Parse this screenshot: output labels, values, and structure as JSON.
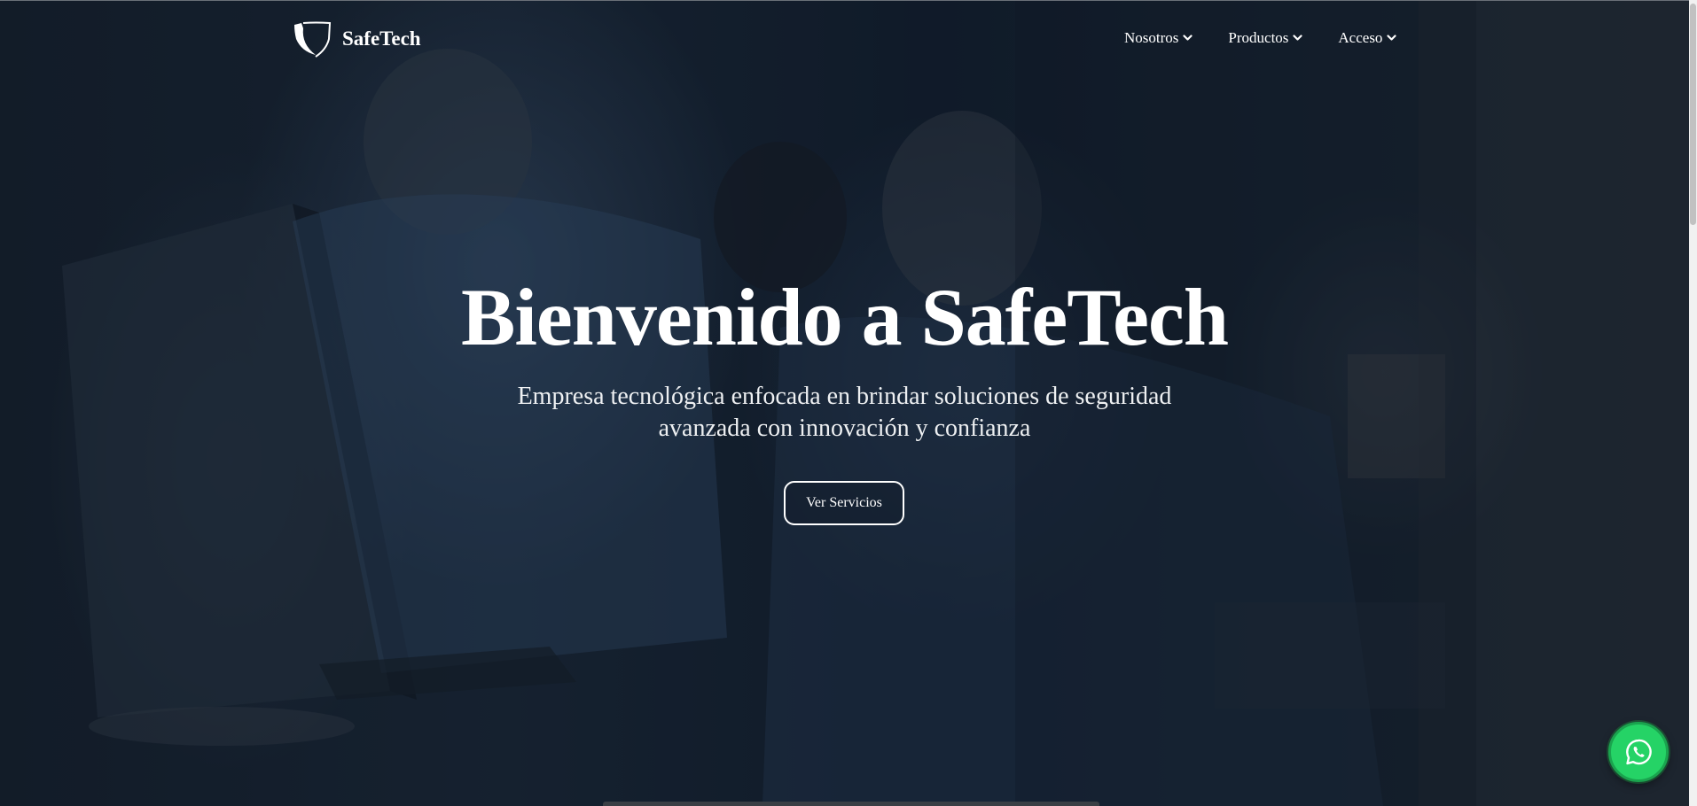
{
  "brand": {
    "name": "SafeTech",
    "logo_icon": "shield-outline-icon"
  },
  "nav": {
    "items": [
      {
        "label": "Nosotros",
        "icon": "chevron-down-icon"
      },
      {
        "label": "Productos",
        "icon": "chevron-down-icon"
      },
      {
        "label": "Acceso",
        "icon": "chevron-down-icon"
      }
    ]
  },
  "hero": {
    "title": "Bienvenido a SafeTech",
    "subtitle": "Empresa tecnológica enfocada en brindar soluciones de seguridad avanzada con innovación y confianza",
    "cta_label": "Ver Servicios"
  },
  "floating": {
    "whatsapp_icon": "whatsapp-icon",
    "color": "#25d366"
  },
  "colors": {
    "text": "#ffffff",
    "background": "#0e1622"
  }
}
